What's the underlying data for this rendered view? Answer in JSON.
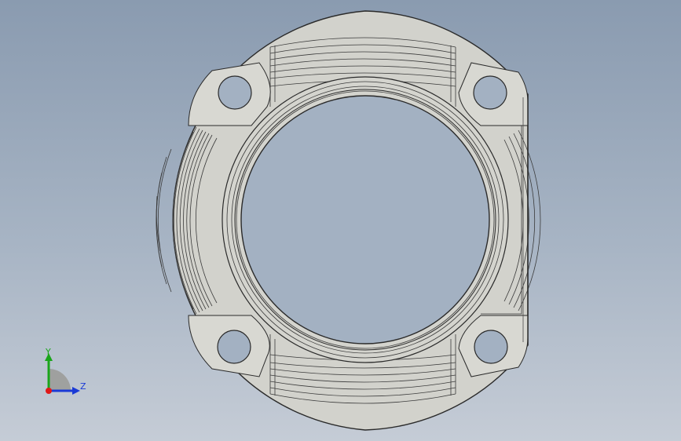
{
  "viewport": {
    "background_top": "#8a9bb0",
    "background_bottom": "#c5ccd6"
  },
  "model": {
    "name": "flange-part",
    "face_color": "#d2d2cc",
    "edge_color": "#2a2a2a",
    "bolt_hole_count": 4
  },
  "triad": {
    "y_label": "Y",
    "z_label": "Z",
    "y_color": "#1aa51a",
    "z_color": "#1a3ad6",
    "x_color": "#e01818"
  }
}
